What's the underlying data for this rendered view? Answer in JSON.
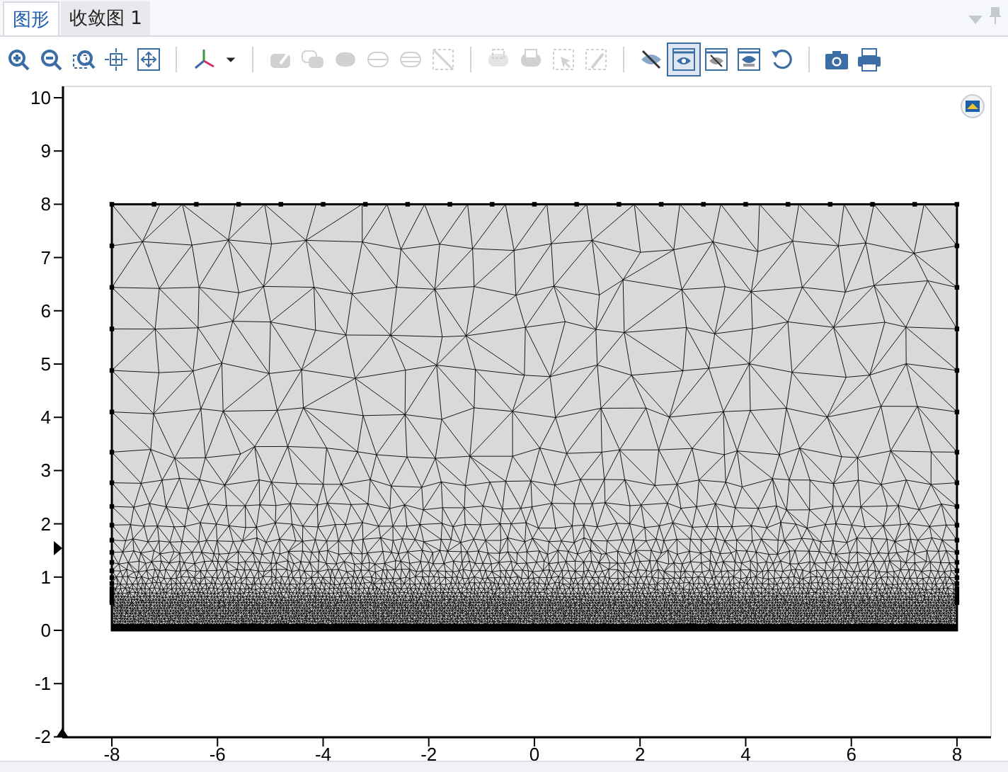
{
  "tabs": [
    {
      "label": "图形",
      "selected": true
    },
    {
      "label": "收敛图 1",
      "selected": false
    }
  ],
  "toolbar": {
    "groups": [
      [
        {
          "kind": "zoom-in",
          "disabled": false,
          "selected": false
        },
        {
          "kind": "zoom-out",
          "disabled": false,
          "selected": false
        },
        {
          "kind": "zoom-box",
          "disabled": false,
          "selected": false
        },
        {
          "kind": "center",
          "disabled": false,
          "selected": false
        },
        {
          "kind": "zoom-extents",
          "disabled": false,
          "selected": false
        }
      ],
      [
        {
          "kind": "axes",
          "disabled": false,
          "selected": false
        },
        {
          "kind": "caret",
          "disabled": false,
          "selected": false
        }
      ],
      [
        {
          "kind": "edit",
          "disabled": true,
          "selected": false
        },
        {
          "kind": "union",
          "disabled": true,
          "selected": false
        },
        {
          "kind": "pill",
          "disabled": true,
          "selected": false
        },
        {
          "kind": "split",
          "disabled": true,
          "selected": false
        },
        {
          "kind": "split2",
          "disabled": true,
          "selected": false
        },
        {
          "kind": "slash-box",
          "disabled": true,
          "selected": false
        }
      ],
      [
        {
          "kind": "select-box",
          "disabled": true,
          "selected": false
        },
        {
          "kind": "select-fill",
          "disabled": true,
          "selected": false
        },
        {
          "kind": "arrow-box",
          "disabled": true,
          "selected": false
        },
        {
          "kind": "pen-box",
          "disabled": true,
          "selected": false
        }
      ],
      [
        {
          "kind": "eye-off",
          "disabled": false,
          "selected": false
        },
        {
          "kind": "eye-window",
          "disabled": false,
          "selected": true
        },
        {
          "kind": "eye-off-window",
          "disabled": false,
          "selected": false
        },
        {
          "kind": "eye-split-window",
          "disabled": false,
          "selected": false
        },
        {
          "kind": "reset",
          "disabled": false,
          "selected": false
        }
      ],
      [
        {
          "kind": "camera",
          "disabled": false,
          "selected": false
        },
        {
          "kind": "print",
          "disabled": false,
          "selected": false
        }
      ]
    ]
  },
  "plot": {
    "x_axis": {
      "ticks": [
        "-8",
        "-6",
        "-4",
        "-2",
        "0",
        "2",
        "4",
        "6",
        "8"
      ]
    },
    "y_axis": {
      "ticks": [
        "10",
        "9",
        "8",
        "7",
        "6",
        "5",
        "4",
        "3",
        "2",
        "1",
        "0",
        "-1",
        "-2"
      ]
    }
  }
}
